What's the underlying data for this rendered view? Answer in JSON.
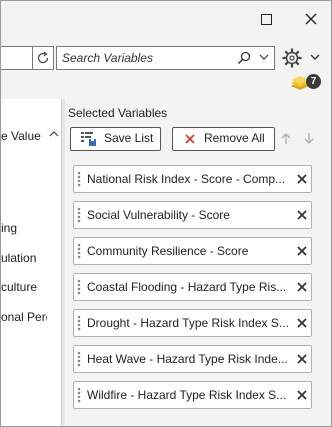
{
  "left_panel": {
    "column_header": "e Value",
    "rows": [
      "ing",
      "ulation",
      "culture",
      "onal Perc"
    ]
  },
  "search": {
    "placeholder": "Search Variables"
  },
  "badge": {
    "count": "7"
  },
  "selected_variables": {
    "title": "Selected Variables",
    "save_label": "Save List",
    "remove_all_label": "Remove All",
    "items": [
      {
        "label": "National Risk Index - Score - Composite"
      },
      {
        "label": "Social Vulnerability - Score"
      },
      {
        "label": "Community Resilience - Score"
      },
      {
        "label": "Coastal Flooding - Hazard Type Risk Index Score"
      },
      {
        "label": "Drought - Hazard Type Risk Index Score"
      },
      {
        "label": "Heat Wave - Hazard Type Risk Index Score"
      },
      {
        "label": "Wildfire - Hazard Type Risk Index Score"
      }
    ]
  },
  "colors": {
    "toolbar_bg": "#f3f3f3",
    "remove_x": "#d9362b",
    "badge_bg": "#3a3a3a",
    "layers_yellow": "#f2c12e"
  }
}
